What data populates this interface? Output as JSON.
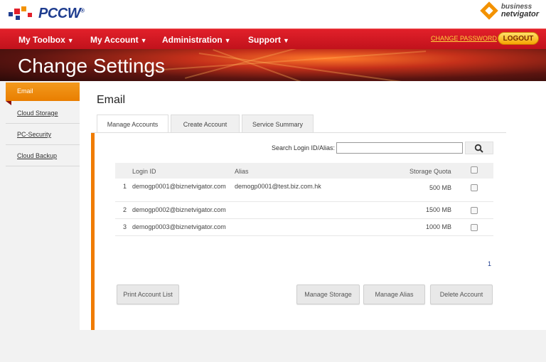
{
  "brand": {
    "logo_text": "PCCW",
    "logo_reg": "®",
    "partner_line1": "business",
    "partner_line2": "netvigator"
  },
  "nav": {
    "items": [
      {
        "label": "My Toolbox"
      },
      {
        "label": "My Account"
      },
      {
        "label": "Administration"
      },
      {
        "label": "Support"
      }
    ],
    "change_password": "CHANGE PASSWORD",
    "logout": "LOGOUT"
  },
  "banner": {
    "title": "Change Settings"
  },
  "sidebar": {
    "items": [
      {
        "label": "Email",
        "active": true
      },
      {
        "label": "Cloud Storage"
      },
      {
        "label": "PC-Security"
      },
      {
        "label": "Cloud Backup"
      }
    ]
  },
  "main": {
    "heading": "Email",
    "tabs": [
      {
        "label": "Manage Accounts",
        "active": true
      },
      {
        "label": "Create Account"
      },
      {
        "label": "Service Summary"
      }
    ],
    "search": {
      "label": "Search Login ID/Alias:",
      "value": ""
    },
    "table": {
      "headers": {
        "login": "Login ID",
        "alias": "Alias",
        "quota": "Storage Quota"
      },
      "rows": [
        {
          "index": "1",
          "login": "demogp0001@biznetvigator.com",
          "alias": "demogp0001@test.biz.com.hk",
          "quota": "500 MB"
        },
        {
          "index": "2",
          "login": "demogp0002@biznetvigator.com",
          "alias": "",
          "quota": "1500 MB"
        },
        {
          "index": "3",
          "login": "demogp0003@biznetvigator.com",
          "alias": "",
          "quota": "1000 MB"
        }
      ]
    },
    "pager": "1",
    "buttons": {
      "print": "Print Account List",
      "manage_storage": "Manage Storage",
      "manage_alias": "Manage Alias",
      "delete": "Delete Account"
    }
  },
  "colors": {
    "nav_red": "#d41a24",
    "accent_orange": "#f07c00",
    "logout_yellow": "#f6a400",
    "brand_blue": "#1f3d8f"
  }
}
